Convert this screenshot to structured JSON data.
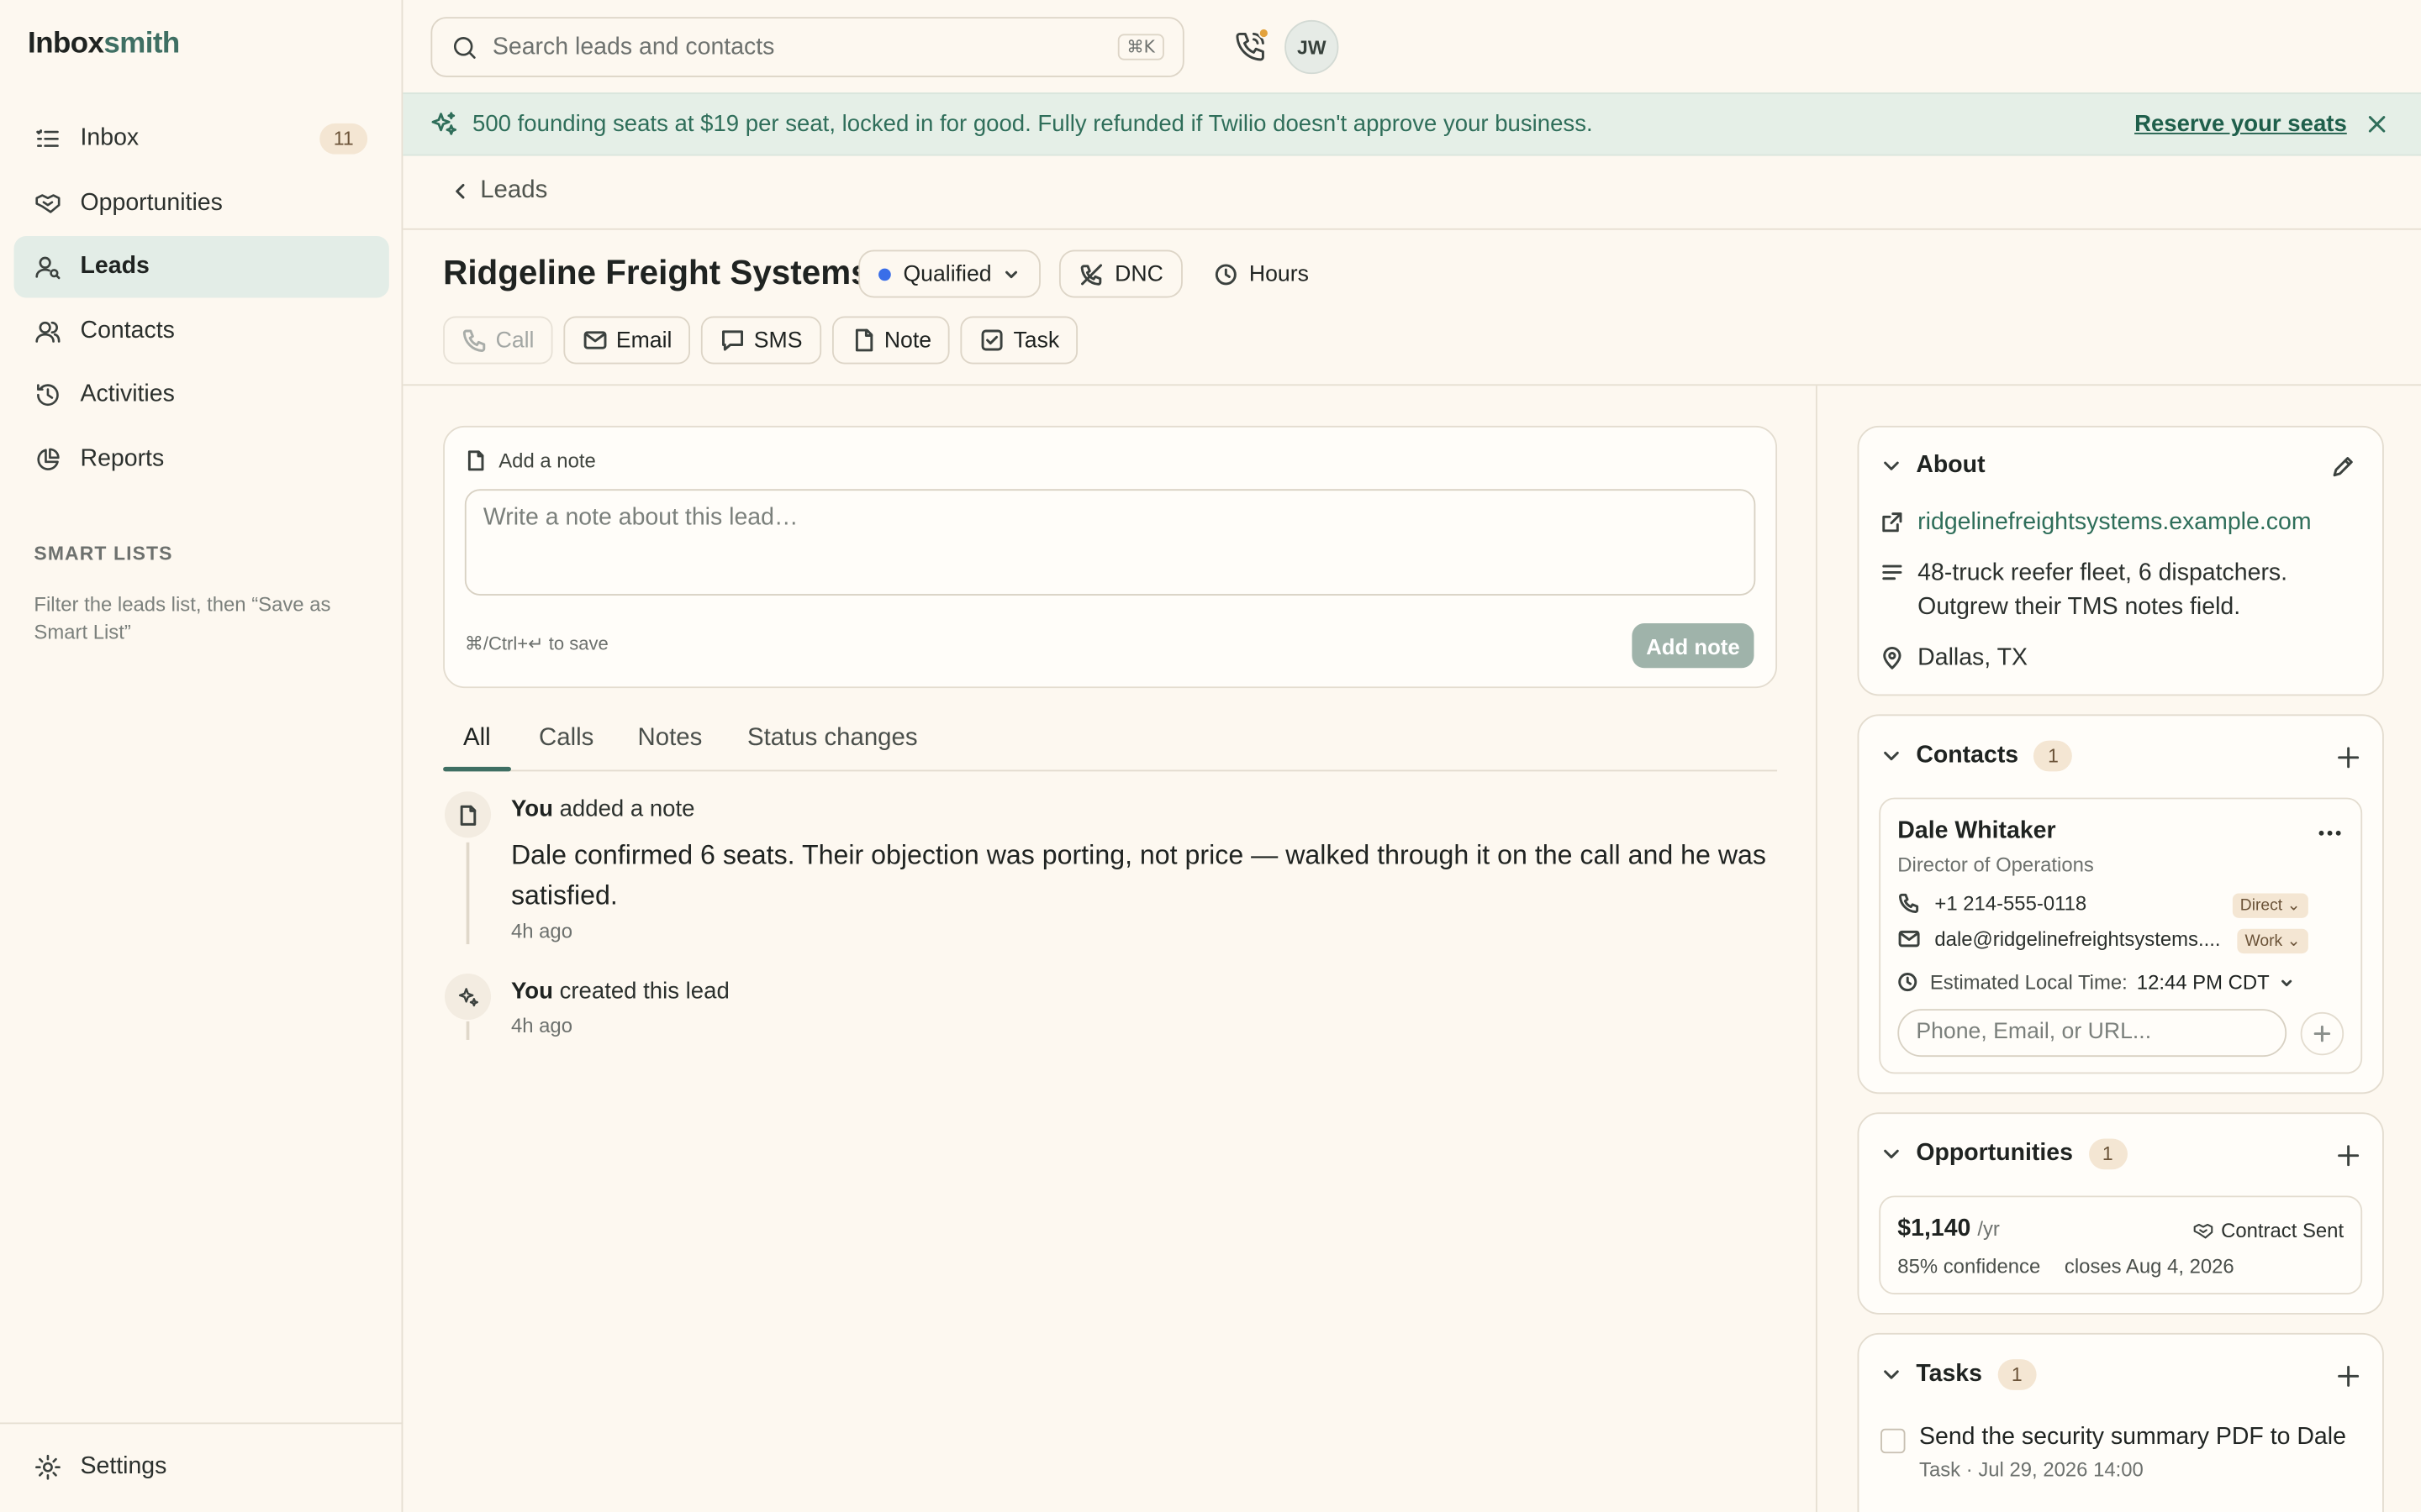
{
  "brand": {
    "part1": "Inbox",
    "part2": "smith"
  },
  "nav": {
    "items": [
      {
        "label": "Inbox",
        "icon": "inbox-list-icon",
        "count": "11"
      },
      {
        "label": "Opportunities",
        "icon": "handshake-icon"
      },
      {
        "label": "Leads",
        "icon": "user-search-icon",
        "active": true
      },
      {
        "label": "Contacts",
        "icon": "users-icon"
      },
      {
        "label": "Activities",
        "icon": "history-icon"
      },
      {
        "label": "Reports",
        "icon": "pie-chart-icon"
      }
    ],
    "smart_lists_title": "SMART LISTS",
    "smart_lists_desc": "Filter the leads list, then “Save as Smart List”",
    "settings_label": "Settings"
  },
  "topbar": {
    "search_placeholder": "Search leads and contacts",
    "search_shortcut": "⌘K",
    "avatar_initials": "JW"
  },
  "banner": {
    "text": "500 founding seats at $19 per seat, locked in for good. Fully refunded if Twilio doesn't approve your business.",
    "cta": "Reserve your seats",
    "accent": "#2f6e5a"
  },
  "breadcrumb": {
    "back_label": "Leads"
  },
  "lead": {
    "name": "Ridgeline Freight Systems",
    "status": "Qualified",
    "status_color": "#3a6ee8",
    "dnc_label": "DNC",
    "hours_label": "Hours",
    "actions": {
      "call": "Call",
      "email": "Email",
      "sms": "SMS",
      "note": "Note",
      "task": "Task"
    }
  },
  "composer": {
    "label": "Add a note",
    "placeholder": "Write a note about this lead…",
    "hint": "⌘/Ctrl+↵ to save",
    "button": "Add note"
  },
  "tabs": [
    "All",
    "Calls",
    "Notes",
    "Status changes"
  ],
  "timeline": [
    {
      "actor": "You",
      "action": "added a note",
      "body": "Dale confirmed 6 seats. Their objection was porting, not price — walked through it on the call and he was satisfied.",
      "time": "4h ago"
    },
    {
      "actor": "You",
      "action": "created this lead",
      "time": "4h ago"
    }
  ],
  "about": {
    "title": "About",
    "website": "ridgelinefreightsystems.example.com",
    "description_line1": "48-truck reefer fleet, 6 dispatchers.",
    "description_line2": "Outgrew their TMS notes field.",
    "location": "Dallas, TX"
  },
  "contacts": {
    "title": "Contacts",
    "count": "1",
    "items": [
      {
        "name": "Dale Whitaker",
        "role": "Director of Operations",
        "phone": "+1 214-555-0118",
        "phone_tag": "Direct",
        "email": "dale@ridgelinefreightsystems....",
        "email_tag": "Work",
        "local_time_label": "Estimated Local Time:",
        "local_time_value": "12:44 PM CDT"
      }
    ],
    "input_placeholder": "Phone, Email, or URL..."
  },
  "opportunities": {
    "title": "Opportunities",
    "count": "1",
    "items": [
      {
        "amount": "$1,140",
        "period": "/yr",
        "stage": "Contract Sent",
        "confidence": "85% confidence",
        "closes": "closes Aug 4, 2026"
      }
    ]
  },
  "tasks": {
    "title": "Tasks",
    "count": "1",
    "items": [
      {
        "title": "Send the security summary PDF to Dale",
        "meta": "Task · Jul 29, 2026 14:00"
      }
    ]
  }
}
